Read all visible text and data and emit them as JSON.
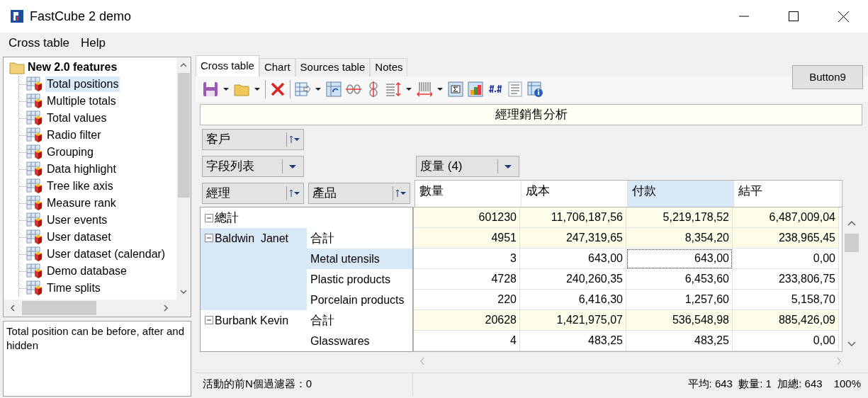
{
  "window": {
    "title": "FastCube 2 demo"
  },
  "menu": [
    {
      "label": "Cross table"
    },
    {
      "label": "Help"
    }
  ],
  "tree": {
    "label": "New 2.0 features",
    "expanded": true,
    "children": [
      {
        "label": "Total positions",
        "selected": true
      },
      {
        "label": "Multiple totals",
        "selected": false
      },
      {
        "label": "Total values",
        "selected": false
      },
      {
        "label": "Radio filter",
        "selected": false
      },
      {
        "label": "Grouping",
        "selected": false
      },
      {
        "label": "Data highlight",
        "selected": false
      },
      {
        "label": "Tree like axis",
        "selected": false
      },
      {
        "label": "Measure rank",
        "selected": false
      },
      {
        "label": "User events",
        "selected": false
      },
      {
        "label": "User dataset",
        "selected": false
      },
      {
        "label": "User dataset (calendar)",
        "selected": false
      },
      {
        "label": "Demo database",
        "selected": false
      },
      {
        "label": "Time splits",
        "selected": false
      }
    ]
  },
  "description": "Total position can be before, after and hidden",
  "tabs": [
    {
      "label": "Cross table",
      "selected": true
    },
    {
      "label": "Chart",
      "selected": false
    },
    {
      "label": "Sources table",
      "selected": false
    },
    {
      "label": "Notes",
      "selected": false
    }
  ],
  "button": "Button9",
  "grid": {
    "title": "經理銷售分析",
    "filter_fields": [
      {
        "label": "客戶",
        "kind": "sort-filter"
      }
    ],
    "field_list": {
      "label": "字段列表",
      "kind": "dropdown"
    },
    "measures_field": {
      "label": "度量 (4)",
      "kind": "dropdown"
    },
    "row_fields": [
      {
        "label": "經理",
        "kind": "sort-filter"
      },
      {
        "label": "產品",
        "kind": "sort-filter"
      }
    ],
    "columns": [
      {
        "label": "數量",
        "selected": false
      },
      {
        "label": "成本",
        "selected": false
      },
      {
        "label": "付款",
        "selected": true
      },
      {
        "label": "結平",
        "selected": false
      }
    ],
    "grand_total": {
      "label": "總計",
      "expanded": true,
      "cells": [
        {
          "text": "601230",
          "focused": false
        },
        {
          "text": "11,706,187,56",
          "focused": false
        },
        {
          "text": "5,219,178,52",
          "focused": false
        },
        {
          "text": "6,487,009,04",
          "focused": false
        }
      ]
    },
    "groups": [
      {
        "label": "Baldwin  Janet",
        "expanded": true,
        "selected": true,
        "rows": [
          {
            "label": "合計",
            "kind": "total",
            "selected": false,
            "cells": [
              {
                "text": "4951",
                "focused": false
              },
              {
                "text": "247,319,65",
                "focused": false
              },
              {
                "text": "8,354,20",
                "focused": false
              },
              {
                "text": "238,965,45",
                "focused": false
              }
            ]
          },
          {
            "label": "Metal utensils",
            "kind": "item",
            "selected": true,
            "cells": [
              {
                "text": "3",
                "focused": false
              },
              {
                "text": "643,00",
                "focused": false
              },
              {
                "text": "643,00",
                "focused": true
              },
              {
                "text": "0,00",
                "focused": false
              }
            ]
          },
          {
            "label": "Plastic products",
            "kind": "item",
            "selected": false,
            "cells": [
              {
                "text": "4728",
                "focused": false
              },
              {
                "text": "240,260,35",
                "focused": false
              },
              {
                "text": "6,453,60",
                "focused": false
              },
              {
                "text": "233,806,75",
                "focused": false
              }
            ]
          },
          {
            "label": "Porcelain products",
            "kind": "item",
            "selected": false,
            "cells": [
              {
                "text": "220",
                "focused": false
              },
              {
                "text": "6,416,30",
                "focused": false
              },
              {
                "text": "1,257,60",
                "focused": false
              },
              {
                "text": "5,158,70",
                "focused": false
              }
            ]
          }
        ]
      },
      {
        "label": "Burbank Kevin",
        "expanded": true,
        "selected": false,
        "rows": [
          {
            "label": "合計",
            "kind": "total",
            "selected": false,
            "cells": [
              {
                "text": "20628",
                "focused": false
              },
              {
                "text": "1,421,975,07",
                "focused": false
              },
              {
                "text": "536,548,98",
                "focused": false
              },
              {
                "text": "885,426,09",
                "focused": false
              }
            ]
          },
          {
            "label": "Glasswares",
            "kind": "item",
            "selected": false,
            "cells": [
              {
                "text": "4",
                "focused": false
              },
              {
                "text": "483,25",
                "focused": false
              },
              {
                "text": "483,25",
                "focused": false
              },
              {
                "text": "0,00",
                "focused": false
              }
            ]
          }
        ]
      }
    ]
  },
  "status_bar": {
    "filter": "活動的前N個過濾器：0",
    "summary": "平均: 643  數量: 1  加總: 643",
    "zoom": "100%"
  }
}
